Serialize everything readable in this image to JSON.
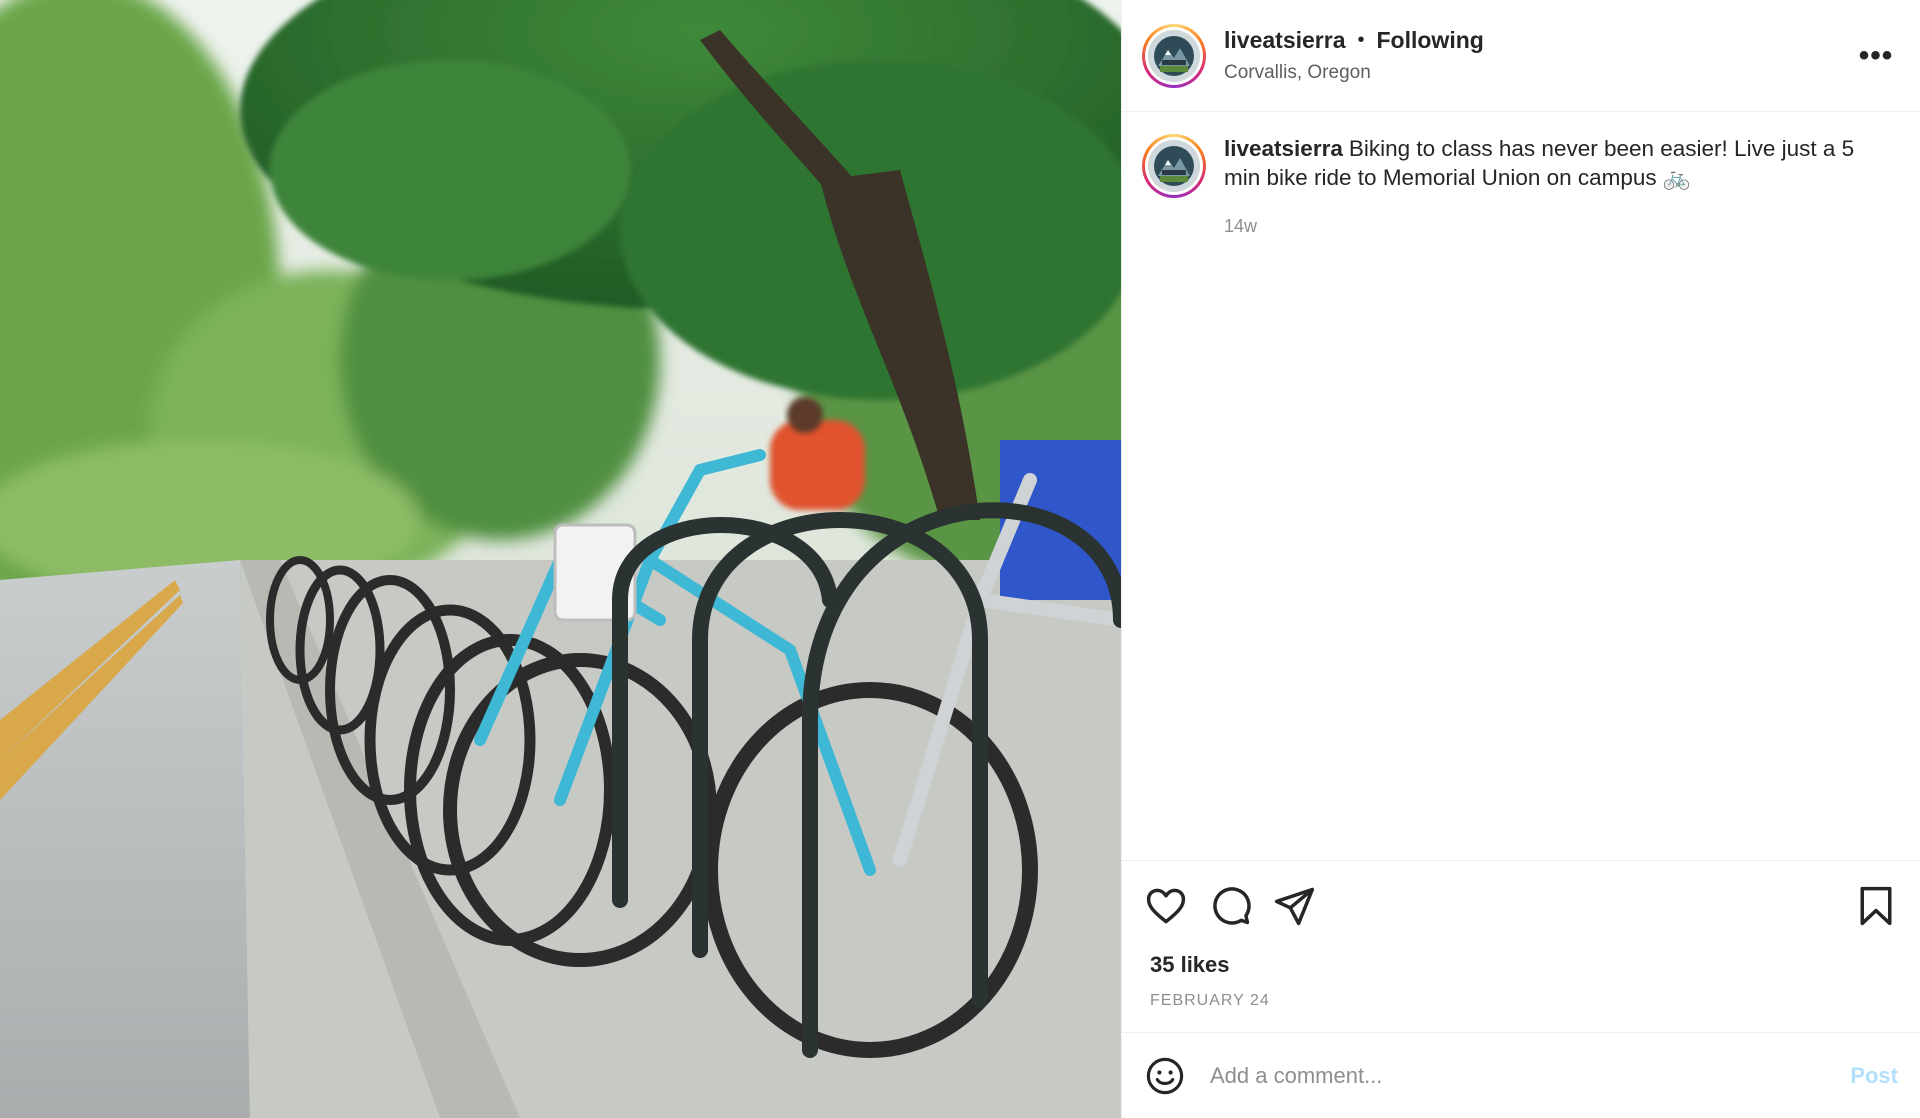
{
  "post": {
    "image_alt": "Row of bicycles parked on a campus bike rack under green trees",
    "header": {
      "username": "liveatsierra",
      "separator": "•",
      "follow_status": "Following",
      "location": "Corvallis, Oregon",
      "more_label": "•••",
      "avatar_icon": "sierra-logo-avatar"
    },
    "caption": {
      "username": "liveatsierra",
      "text": "Biking to class has never been easier! Live just a 5 min bike ride to Memorial Union on campus 🚲",
      "time_ago": "14w"
    },
    "actions": {
      "like_icon": "heart-icon",
      "comment_icon": "comment-icon",
      "share_icon": "share-icon",
      "save_icon": "bookmark-icon"
    },
    "likes": "35 likes",
    "date": "FEBRUARY 24",
    "comment_box": {
      "emoji_icon": "emoji-icon",
      "placeholder": "Add a comment...",
      "post_label": "Post"
    }
  },
  "colors": {
    "text": "#262626",
    "muted": "#8e8e8e",
    "post_button_disabled": "#b2dffc",
    "border": "#efefef"
  }
}
